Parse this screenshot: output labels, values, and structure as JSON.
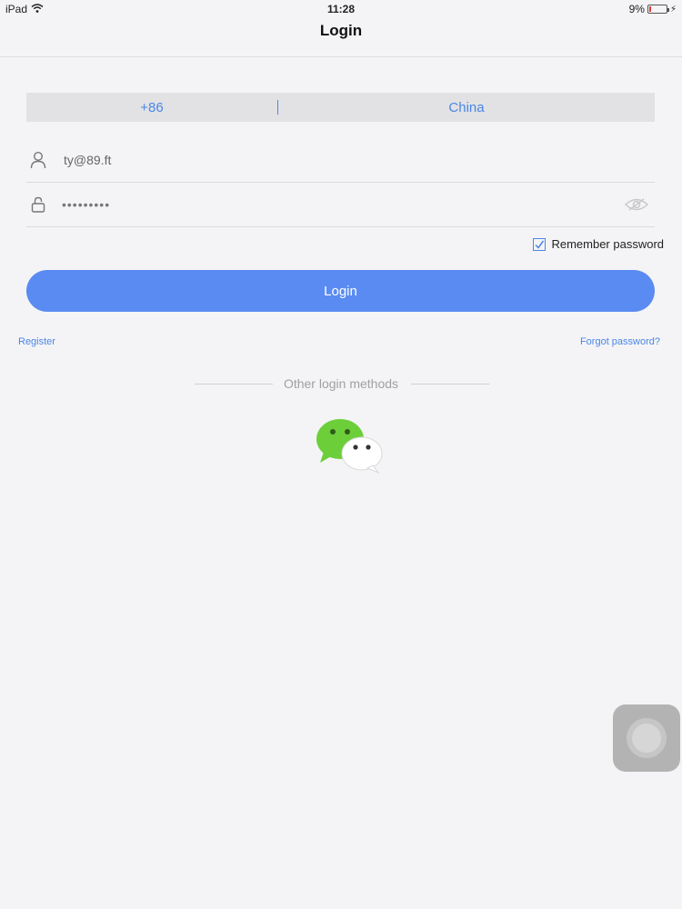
{
  "status_bar": {
    "device": "iPad",
    "time": "11:28",
    "battery_percent": "9%",
    "battery_level": 0.09,
    "icons": [
      "wifi-icon",
      "battery-icon",
      "charging-bolt-icon"
    ]
  },
  "nav": {
    "title": "Login"
  },
  "country": {
    "code": "+86",
    "name": "China"
  },
  "username": {
    "value": "ty@89.ft",
    "icon": "user-icon"
  },
  "password": {
    "masked_value": "•••••••••",
    "icon": "lock-icon",
    "toggle_icon": "eye-hidden-icon"
  },
  "remember": {
    "label": "Remember password",
    "checked": true
  },
  "login_button": {
    "label": "Login"
  },
  "links": {
    "register": "Register",
    "forgot": "Forgot password?"
  },
  "other_methods": {
    "label": "Other login methods",
    "icons": [
      "wechat-icon"
    ]
  },
  "colors": {
    "accent": "#4a86e8",
    "button": "#5a8bf2",
    "background": "#f4f4f6",
    "wechat_green": "#6ccf3a"
  }
}
